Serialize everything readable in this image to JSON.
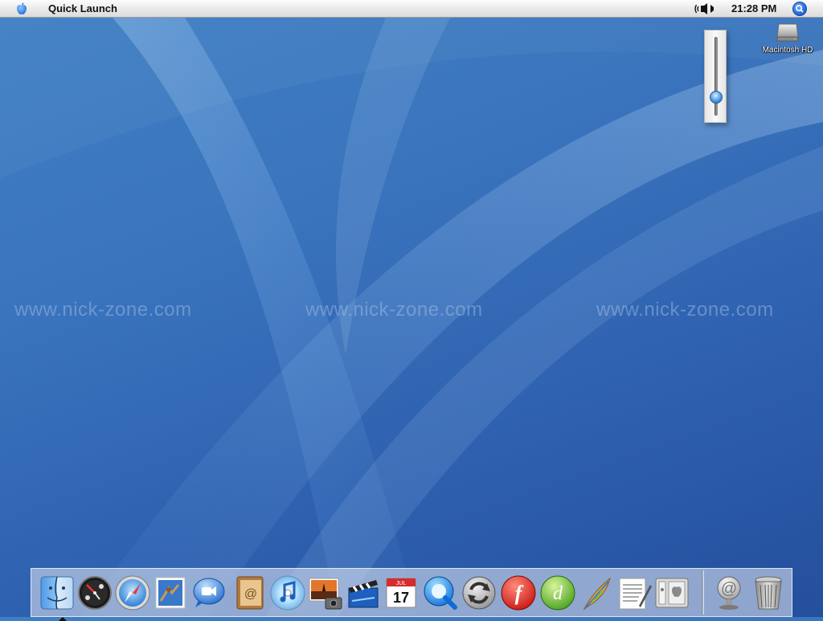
{
  "menubar": {
    "app_name": "Quick Launch",
    "clock": "21:28 PM",
    "apple_icon": "apple-logo-icon",
    "volume_icon": "speaker-volume-icon",
    "spotlight_icon": "spotlight-search-icon"
  },
  "volume_slider": {
    "level": 0.18
  },
  "desktop": {
    "hd_label": "Macintosh HD",
    "watermark": "www.nick-zone.com"
  },
  "dock": {
    "items": [
      {
        "name": "finder",
        "icon": "finder-icon",
        "running": true
      },
      {
        "name": "dashboard",
        "icon": "dashboard-icon"
      },
      {
        "name": "safari",
        "icon": "safari-compass-icon"
      },
      {
        "name": "mail",
        "icon": "mail-stamp-icon"
      },
      {
        "name": "ichat",
        "icon": "ichat-video-icon"
      },
      {
        "name": "address-book",
        "icon": "address-book-icon"
      },
      {
        "name": "itunes",
        "icon": "itunes-cd-icon"
      },
      {
        "name": "iphoto",
        "icon": "iphoto-icon"
      },
      {
        "name": "imovie",
        "icon": "imovie-clapper-icon"
      },
      {
        "name": "ical",
        "icon": "ical-calendar-icon",
        "text": "17",
        "month": "JUL"
      },
      {
        "name": "quicktime",
        "icon": "quicktime-icon"
      },
      {
        "name": "isync",
        "icon": "isync-icon"
      },
      {
        "name": "flash",
        "icon": "flash-icon",
        "text": "f"
      },
      {
        "name": "dreamweaver",
        "icon": "dreamweaver-icon",
        "text": "d"
      },
      {
        "name": "fireworks",
        "icon": "feather-icon"
      },
      {
        "name": "textedit",
        "icon": "textedit-icon"
      },
      {
        "name": "system-prefs",
        "icon": "system-preferences-icon"
      },
      {
        "name": "mail-at",
        "icon": "at-sign-icon",
        "text": "@"
      },
      {
        "name": "trash",
        "icon": "trash-icon"
      }
    ]
  },
  "colors": {
    "desktop_top": "#3f7fc4",
    "desktop_bottom": "#244f9c",
    "accent": "#1f5fd9"
  }
}
